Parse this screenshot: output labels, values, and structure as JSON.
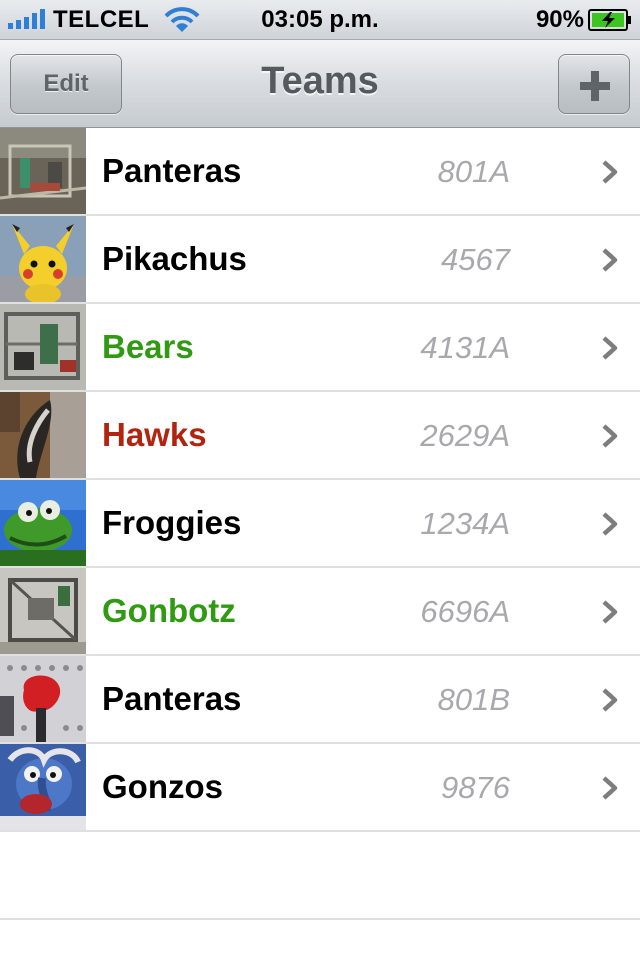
{
  "status_bar": {
    "carrier": "TELCEL",
    "time": "03:05 p.m.",
    "battery_percent": "90%",
    "signal_icon": "signal-bars-icon",
    "wifi_icon": "wifi-icon",
    "battery_icon": "battery-charging-icon"
  },
  "nav": {
    "title": "Teams",
    "edit_label": "Edit",
    "add_icon": "plus-icon"
  },
  "colors": {
    "default_name": "#000000",
    "green_name": "#2f9a12",
    "red_name": "#b3240f",
    "number": "#a9a9ad"
  },
  "teams": [
    {
      "name": "Panteras",
      "number": "801A",
      "color": "#000000",
      "thumb": "robot-photo"
    },
    {
      "name": "Pikachus",
      "number": "4567",
      "color": "#000000",
      "thumb": "pikachu-photo"
    },
    {
      "name": "Bears",
      "number": "4131A",
      "color": "#2f9a12",
      "thumb": "robot-photo"
    },
    {
      "name": "Hawks",
      "number": "2629A",
      "color": "#b3240f",
      "thumb": "hawk-photo"
    },
    {
      "name": "Froggies",
      "number": "1234A",
      "color": "#000000",
      "thumb": "frog-puppet-photo"
    },
    {
      "name": "Gonbotz",
      "number": "6696A",
      "color": "#2f9a12",
      "thumb": "robot-photo"
    },
    {
      "name": "Panteras",
      "number": "801B",
      "color": "#000000",
      "thumb": "robot-photo"
    },
    {
      "name": "Gonzos",
      "number": "9876",
      "color": "#000000",
      "thumb": "gonzo-puppet-photo"
    }
  ]
}
